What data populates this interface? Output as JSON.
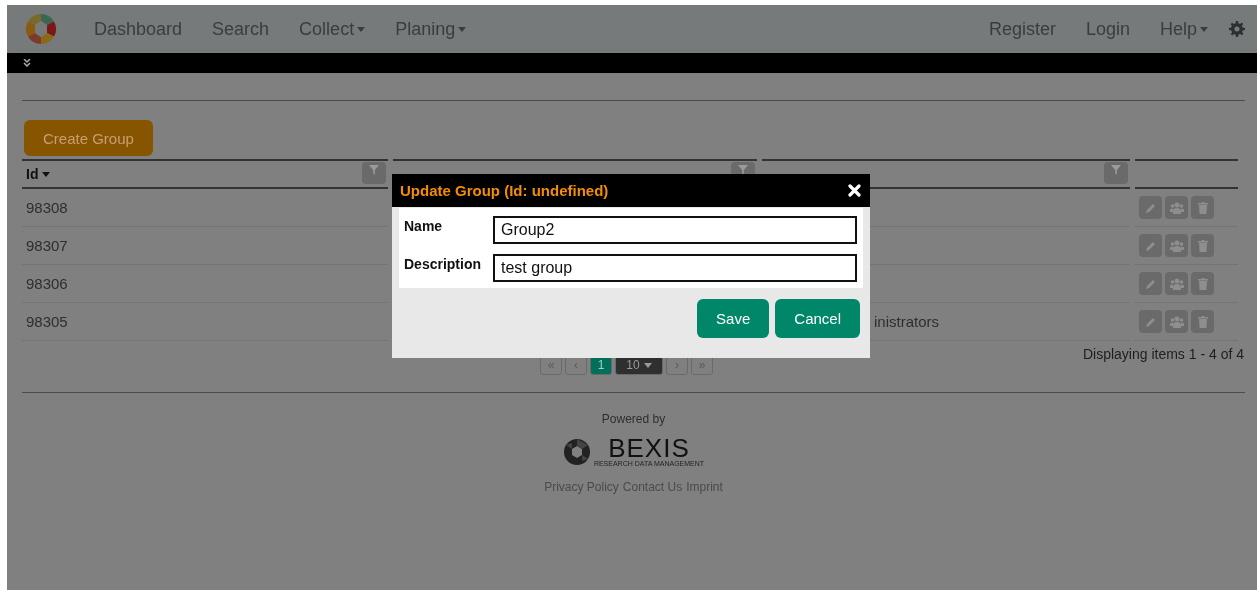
{
  "nav": {
    "menu": [
      {
        "label": "Dashboard",
        "dropdown": false
      },
      {
        "label": "Search",
        "dropdown": false
      },
      {
        "label": "Collect",
        "dropdown": true
      },
      {
        "label": "Planing",
        "dropdown": true
      }
    ],
    "right": [
      {
        "label": "Register",
        "dropdown": false
      },
      {
        "label": "Login",
        "dropdown": false
      },
      {
        "label": "Help",
        "dropdown": true
      }
    ]
  },
  "create_button": "Create Group",
  "table": {
    "columns": [
      {
        "label": "Id",
        "sortable": true,
        "filter": true
      },
      {
        "filter": true
      },
      {
        "filter": true
      },
      {
        "filter": false
      }
    ],
    "rows": [
      {
        "id": "98308"
      },
      {
        "id": "98307"
      },
      {
        "id": "98306"
      },
      {
        "id": "98305",
        "description": "inistrators"
      }
    ]
  },
  "pager": [
    {
      "kind": "nav",
      "label": "«"
    },
    {
      "kind": "nav",
      "label": "‹"
    },
    {
      "kind": "page",
      "label": "1",
      "selected": true
    },
    {
      "kind": "size",
      "label": "10"
    },
    {
      "kind": "nav",
      "label": "›"
    },
    {
      "kind": "nav",
      "label": "»"
    }
  ],
  "summary": "Displaying items 1 - 4 of 4",
  "footer": {
    "powered_by": "Powered by",
    "logo_text": "BEXIS",
    "logo_tagline": "RESEARCH DATA MANAGEMENT",
    "links": [
      "Privacy Policy",
      "Contact Us",
      "Imprint"
    ]
  },
  "modal": {
    "title": "Update Group (Id: undefined)",
    "fields": [
      {
        "label": "Name",
        "value": "Group2"
      },
      {
        "label": "Description",
        "value": "test group"
      }
    ],
    "buttons": [
      "Save",
      "Cancel"
    ]
  }
}
